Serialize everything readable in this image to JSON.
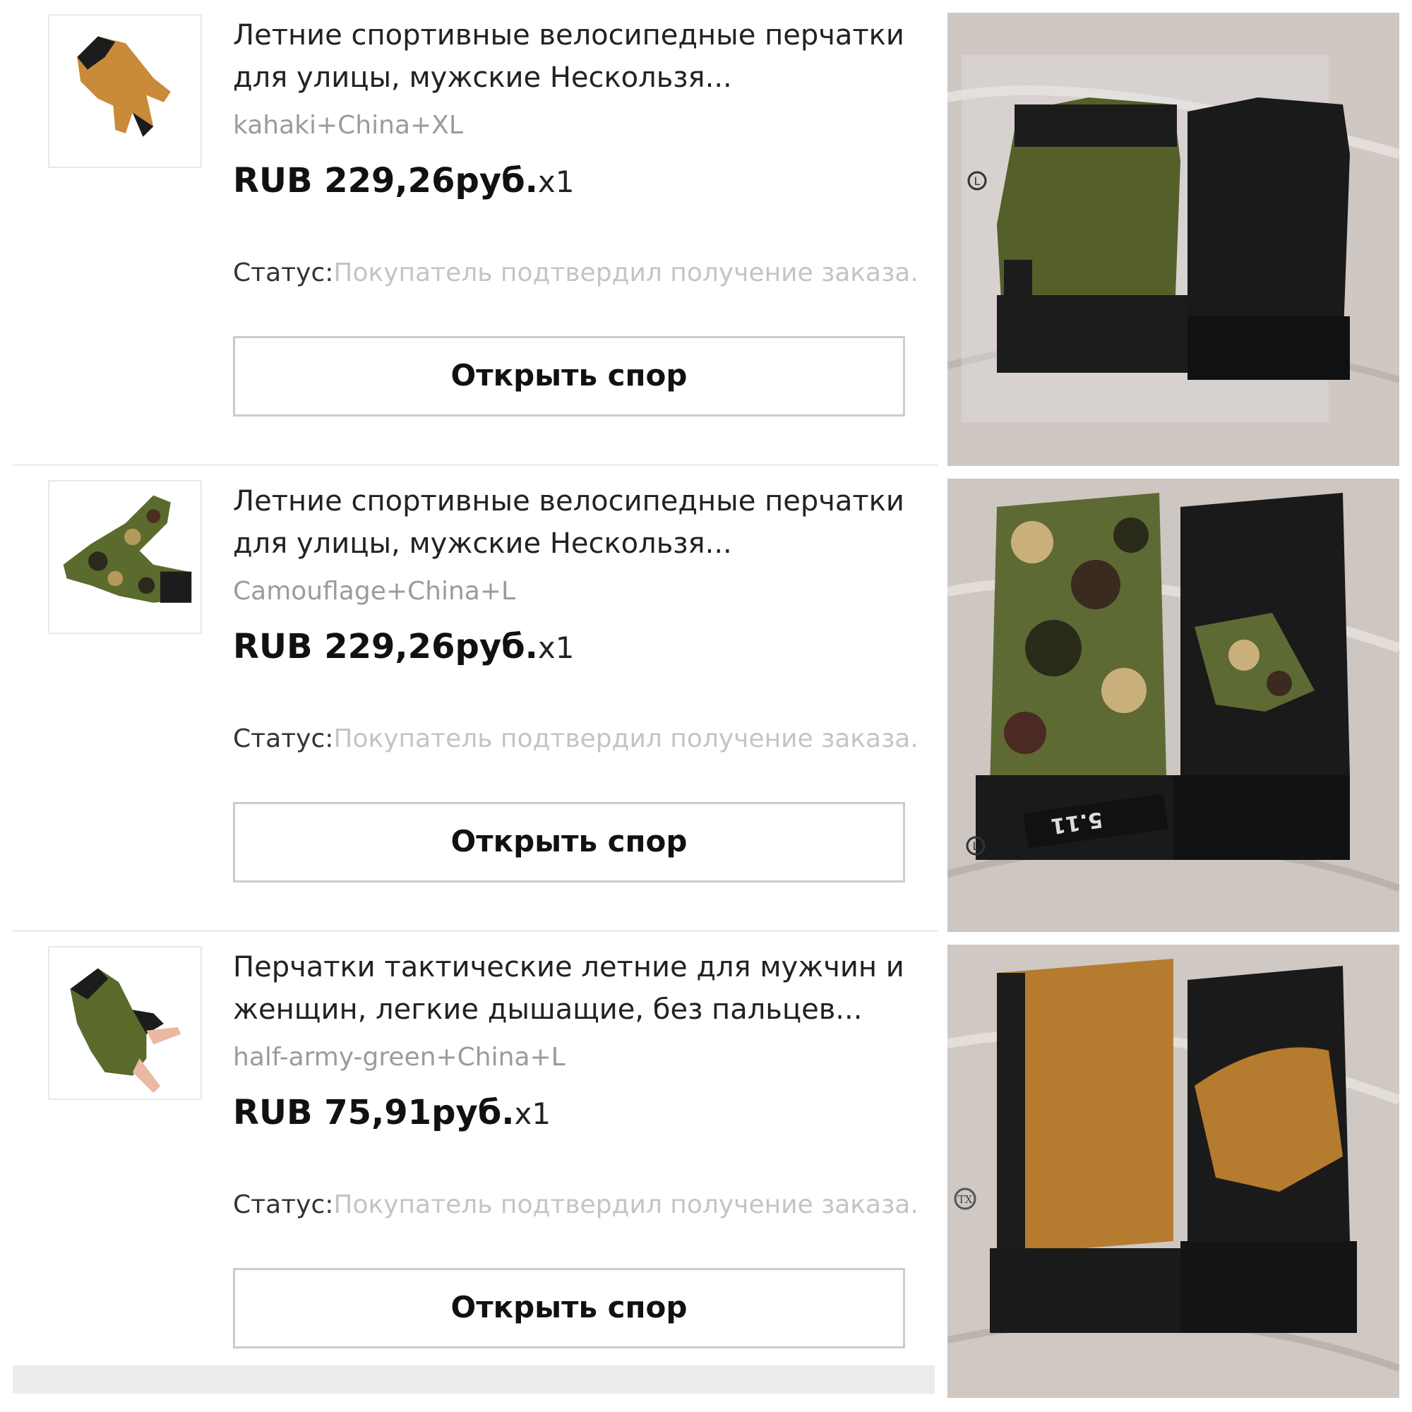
{
  "orders": [
    {
      "title": "Летние спортивные велосипедные перчатки для улицы, мужские Нескользя...",
      "variant": "kahaki+China+XL",
      "price": "RUB 229,26руб.",
      "qty": "x1",
      "status_label": "Статус:",
      "status_text": "Покупатель подтвердил получение заказа.",
      "dispute_label": "Открыть спор"
    },
    {
      "title": "Летние спортивные велосипедные перчатки для улицы, мужские Нескользя...",
      "variant": "Camouflage+China+L",
      "price": "RUB 229,26руб.",
      "qty": "x1",
      "status_label": "Статус:",
      "status_text": "Покупатель подтвердил получение заказа.",
      "dispute_label": "Открыть спор"
    },
    {
      "title": "Перчатки тактические летние для мужчин и женщин, легкие дышащие, без пальцев...",
      "variant": "half-army-green+China+L",
      "price": "RUB 75,91руб.",
      "qty": "x1",
      "status_label": "Статус:",
      "status_text": "Покупатель подтвердил получение заказа.",
      "dispute_label": "Открыть спор"
    }
  ],
  "photos": {
    "photo1": {
      "tag_size": "L"
    },
    "photo2": {
      "tag_size": "L",
      "brand_tag": "5.11"
    },
    "photo3": {
      "tag_size": "TX"
    }
  },
  "colors": {
    "khaki": "#c98a3a",
    "army_green": "#5a6a2a",
    "glove_black": "#1c1c1c",
    "marble": "#cfc7c2"
  }
}
